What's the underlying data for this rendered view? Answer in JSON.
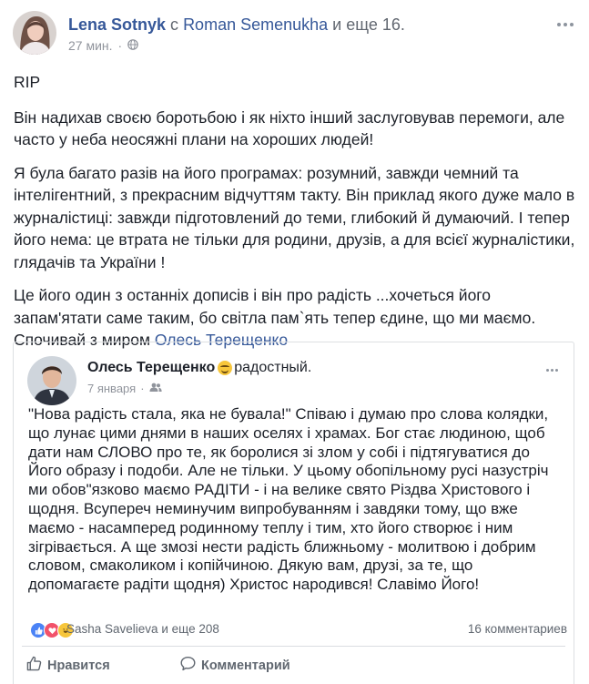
{
  "post": {
    "author": "Lena Sotnyk",
    "with_word": "с",
    "tagged": "Roman Semenukha",
    "and_more": "и еще 16.",
    "timestamp": "27 мин.",
    "paragraphs": {
      "p1": "RIP",
      "p2": "Він надихав своєю боротьбою і як ніхто інший заслуговував перемоги, але часто у неба неосяжні плани на хороших людей!",
      "p3": "Я була багато разів на його програмах: розумний, завжди чемний та інтелігентний, з прекрасним відчуттям такту. Він приклад якого дуже мало в журналістиці: завжди підготовлений до теми, глибокий й думаючий. І тепер його нема: це втрата не тільки для родини, друзів, а для всієї журналістики, глядачів та України !",
      "p4_text": "Це його один з останніх дописів і він про радість ...хочеться його запам'ятати саме таким, бо світла пам`ять тепер єдине, що ми маємо. Спочивай з миром",
      "p4_mention": "Олесь Терещенко"
    }
  },
  "shared": {
    "author": "Олесь Терещенко",
    "feeling": "радостный.",
    "date": "7 января",
    "text": "\"Нова радість стала, яка не бувала!\" Співаю і думаю про слова колядки, що лунає цими днями в наших оселях і храмах. Бог стає людиною, щоб дати нам СЛОВО про те, як боролися зі злом у собі і підтягуватися до Його образу і подоби. Але не тільки. У цьому обопільному русі назустріч ми обов\"язково маємо РАДІТИ - і на велике свято Різдва Христового і щодня. Всупереч неминучим випробуванням і завдяки тому, що вже маємо - насамперед родинному теплу і тим, хто його створює і ним зігрівається. А ще змозі нести радість ближньому - молитвою і добрим словом, смаколиком і копійчиною. Дякую вам, друзі, за те, що допомагаєте радіти щодня) Христос народився! Славімо Його!",
    "reactors": "Sasha Savelieva и еще 208",
    "comments_count": "16 комментариев",
    "like_label": "Нравится",
    "comment_label": "Комментарий"
  },
  "colors": {
    "link": "#365899",
    "text": "#1d2129",
    "muted": "#90949c",
    "like": "#4b83f6",
    "love": "#f2526a",
    "haha": "#f7c63b"
  },
  "icons": [
    "more-icon",
    "globe-icon",
    "friends-icon",
    "like-reaction-icon",
    "love-reaction-icon",
    "haha-reaction-icon",
    "thumbs-up-icon",
    "comment-icon",
    "feeling-emoji-icon"
  ]
}
